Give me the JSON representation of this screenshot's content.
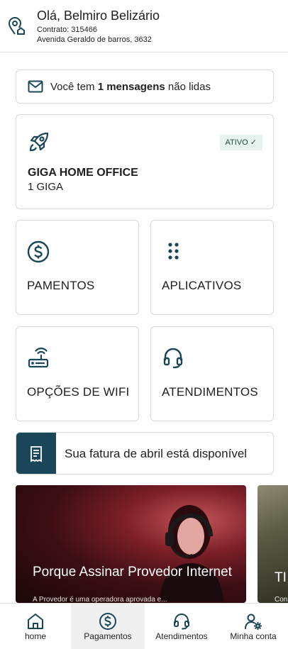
{
  "header": {
    "greeting": "Olá, Belmiro Belizário",
    "contract": "Contrato: 315466",
    "address": "Avenida Geraldo  de barros, 3632"
  },
  "messages": {
    "prefix": "Você tem ",
    "count_text": "1 mensagens",
    "suffix": " não lidas"
  },
  "plan": {
    "status_badge": "ATIVO ✓",
    "name": "GIGA HOME OFFICE",
    "speed": "1 GIGA"
  },
  "tiles": {
    "payments": "PAMENTOS",
    "apps": "APLICATIVOS",
    "wifi": "OPÇÕES DE WIFI",
    "support": "ATENDIMENTOS"
  },
  "invoice": {
    "text": "Sua fatura de abril está disponível"
  },
  "banners": [
    {
      "title": "Porque Assinar Provedor Internet",
      "subtitle": "A Provedor é uma operadora aprovada e..."
    },
    {
      "title": "TI",
      "subtitle": "Con"
    }
  ],
  "bottom_nav": {
    "home": "home",
    "payments": "Pagamentos",
    "support": "Atendimentos",
    "account": "Minha conta",
    "active": "Pagamentos"
  },
  "colors": {
    "accent": "#1a4757",
    "badge_bg": "#e6f3ee",
    "badge_text": "#1e4a3c",
    "active_nav_bg": "#f0f0f0"
  },
  "icons": {
    "header": "location-home-icon",
    "messages": "mail-icon",
    "plan": "rocket-icon",
    "payments": "dollar-circle-icon",
    "apps": "dots-grid-icon",
    "wifi": "router-icon",
    "support": "headset-icon",
    "invoice": "receipt-icon",
    "account": "user-settings-icon"
  }
}
